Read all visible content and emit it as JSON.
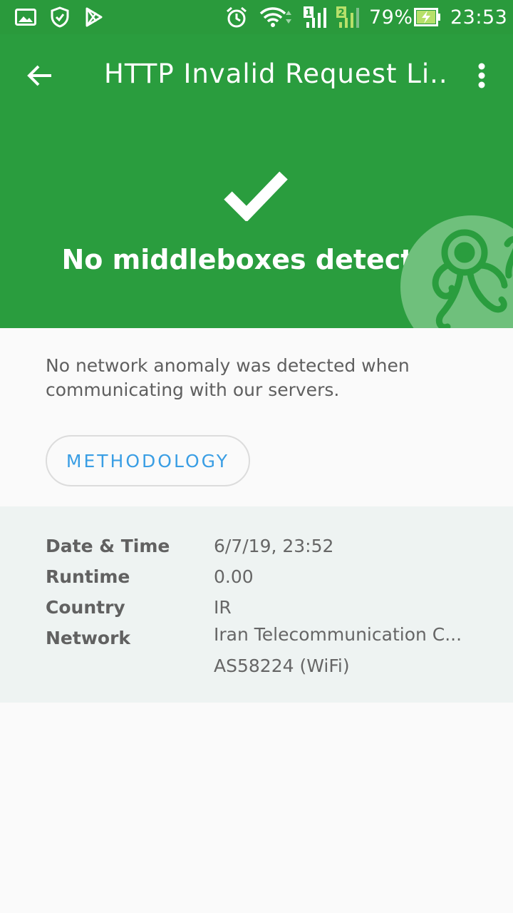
{
  "status_bar": {
    "battery": "79%",
    "time": "23:53",
    "sim1": "1",
    "sim2": "2"
  },
  "app_bar": {
    "title": "HTTP Invalid Request Li...",
    "back_icon": "arrow-back-icon",
    "menu_icon": "more-vert-icon"
  },
  "result": {
    "title": "No middleboxes detected",
    "icon": "check-icon"
  },
  "description": "No network anomaly was detected when communicating with our servers.",
  "methodology_label": "METHODOLOGY",
  "details": {
    "date_label": "Date & Time",
    "date_value": "6/7/19, 23:52",
    "runtime_label": "Runtime",
    "runtime_value": "0.00",
    "country_label": "Country",
    "country_value": "IR",
    "network_label": "Network",
    "network_value": "Iran Telecommunication C...",
    "network_asn": "AS58224 (WiFi)"
  },
  "colors": {
    "header_green": "#2a9d3e",
    "status_green": "#2a9a3c",
    "accent_blue": "#3a9ee4",
    "details_bg": "#eef3f2"
  }
}
